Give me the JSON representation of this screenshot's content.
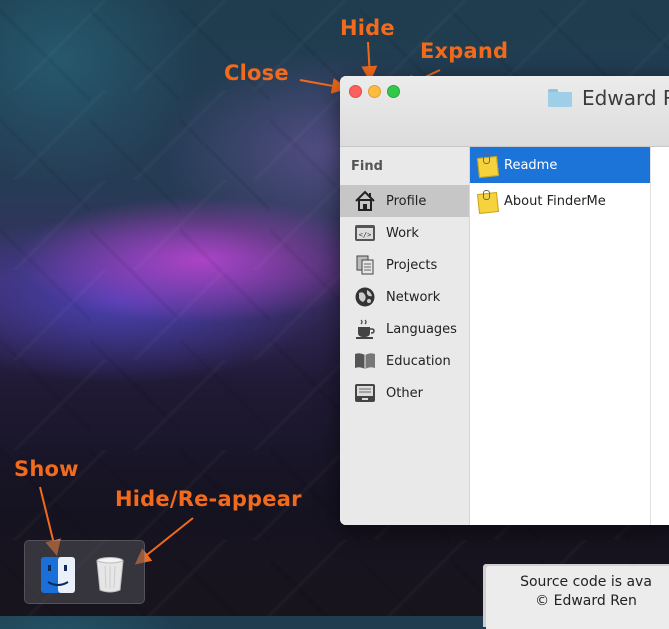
{
  "annotations": {
    "close": "Close",
    "hide": "Hide",
    "expand": "Expand",
    "show": "Show",
    "hide_reappear": "Hide/Re-appear"
  },
  "window": {
    "title": "Edward Re",
    "title_icon": "folder-icon",
    "traffic_lights": {
      "close": "#fc605c",
      "hide": "#fdbc40",
      "expand": "#34c84a"
    }
  },
  "sidebar": {
    "heading": "Find",
    "items": [
      {
        "label": "Profile",
        "icon": "house-icon",
        "selected": true
      },
      {
        "label": "Work",
        "icon": "code-window-icon",
        "selected": false
      },
      {
        "label": "Projects",
        "icon": "documents-icon",
        "selected": false
      },
      {
        "label": "Network",
        "icon": "globe-icon",
        "selected": false
      },
      {
        "label": "Languages",
        "icon": "coffee-cup-icon",
        "selected": false
      },
      {
        "label": "Education",
        "icon": "open-book-icon",
        "selected": false
      },
      {
        "label": "Other",
        "icon": "drawer-icon",
        "selected": false
      }
    ]
  },
  "files": [
    {
      "label": "Readme",
      "icon": "note-icon",
      "selected": true
    },
    {
      "label": "About FinderMe",
      "icon": "note-icon",
      "selected": false
    }
  ],
  "dock": {
    "items": [
      "finder-icon",
      "trash-icon"
    ]
  },
  "notice": {
    "line1": "Source code is ava",
    "line2": "© Edward Ren"
  },
  "colors": {
    "annotation": "#f26a1b",
    "selection": "#1c74d9"
  }
}
